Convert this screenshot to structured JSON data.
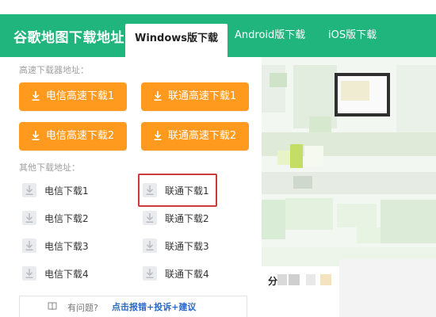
{
  "header": {
    "site_title": "谷歌地图下载地址",
    "tabs": [
      {
        "label": "Windows版下载",
        "active": true
      },
      {
        "label": "Android版下载",
        "active": false
      },
      {
        "label": "iOS版下载",
        "active": false
      }
    ]
  },
  "high_speed": {
    "label": "高速下载器地址：",
    "buttons": [
      {
        "label": "电信高速下载1"
      },
      {
        "label": "联通高速下载1"
      },
      {
        "label": "电信高速下载2"
      },
      {
        "label": "联通高速下载2"
      }
    ]
  },
  "other": {
    "label": "其他下载地址：",
    "links": [
      {
        "label": "电信下载1"
      },
      {
        "label": "联通下载1"
      },
      {
        "label": "电信下载2"
      },
      {
        "label": "联通下载2"
      },
      {
        "label": "电信下载3"
      },
      {
        "label": "联通下载3"
      },
      {
        "label": "电信下载4"
      },
      {
        "label": "联通下载4"
      }
    ]
  },
  "feedback": {
    "question": "有问题?",
    "link": "点击报错+投诉+建议"
  },
  "share": {
    "label": "分"
  },
  "colors": {
    "header_green": "#1fb57d",
    "button_orange": "#ff9a1f",
    "highlight_red": "#c93a3a",
    "link_blue": "#2b69c7"
  }
}
